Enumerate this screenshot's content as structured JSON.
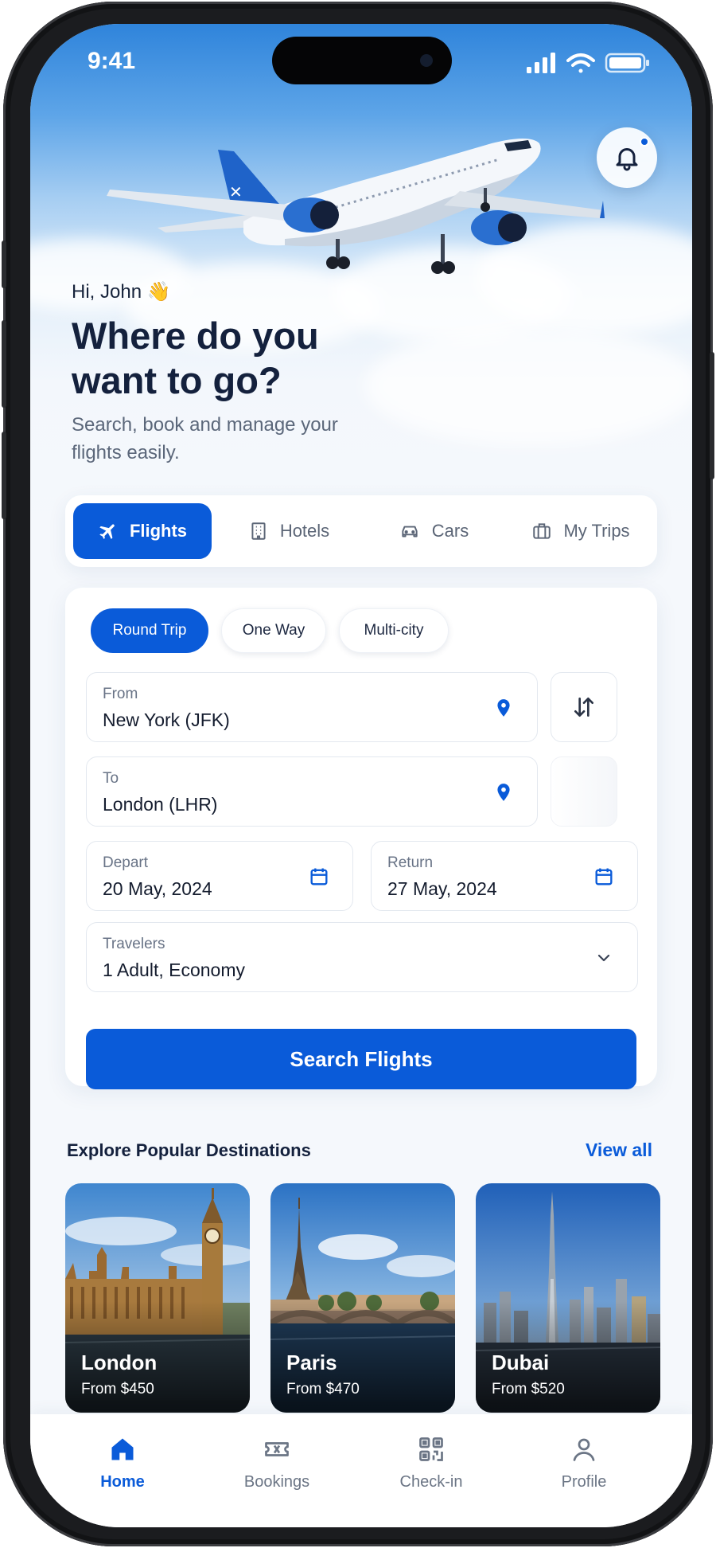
{
  "status_bar": {
    "time": "9:41"
  },
  "hero": {
    "greeting": "Hi, John 👋",
    "headline": "Where do you want to go?",
    "subtitle": "Search, book and manage your flights easily."
  },
  "icons": {
    "notification": "bell-icon",
    "flights": "plane-icon",
    "hotels": "building-icon",
    "cars": "car-icon",
    "trips": "briefcase-icon",
    "location": "map-pin-icon",
    "swap": "swap-arrows-icon",
    "date": "calendar-icon",
    "dropdown": "chevron-down-icon"
  },
  "category_tabs": [
    {
      "label": "Flights",
      "active": true
    },
    {
      "label": "Hotels",
      "active": false
    },
    {
      "label": "Cars",
      "active": false
    },
    {
      "label": "My Trips",
      "active": false
    }
  ],
  "trip_types": [
    {
      "label": "Round Trip",
      "active": true
    },
    {
      "label": "One Way",
      "active": false
    },
    {
      "label": "Multi-city",
      "active": false
    }
  ],
  "search_form": {
    "from": {
      "label": "From",
      "value": "New York (JFK)"
    },
    "to": {
      "label": "To",
      "value": "London (LHR)"
    },
    "depart": {
      "label": "Depart",
      "value": "20 May, 2024"
    },
    "return": {
      "label": "Return",
      "value": "27 May, 2024"
    },
    "travelers": {
      "label": "Travelers",
      "value": "1 Adult, Economy"
    },
    "submit_label": "Search Flights"
  },
  "destinations": {
    "title": "Explore Popular Destinations",
    "view_all": "View all",
    "items": [
      {
        "name": "London",
        "price": "From $450"
      },
      {
        "name": "Paris",
        "price": "From $470"
      },
      {
        "name": "Dubai",
        "price": "From $520"
      }
    ]
  },
  "bottom_nav": [
    {
      "label": "Home",
      "icon": "home-icon",
      "active": true
    },
    {
      "label": "Bookings",
      "icon": "ticket-icon",
      "active": false
    },
    {
      "label": "Check-in",
      "icon": "qr-code-icon",
      "active": false
    },
    {
      "label": "Profile",
      "icon": "user-icon",
      "active": false
    }
  ],
  "colors": {
    "primary": "#0a5bd9",
    "text_dark": "#14213d",
    "text_muted": "#5b677a",
    "background": "#f5f8fc"
  }
}
